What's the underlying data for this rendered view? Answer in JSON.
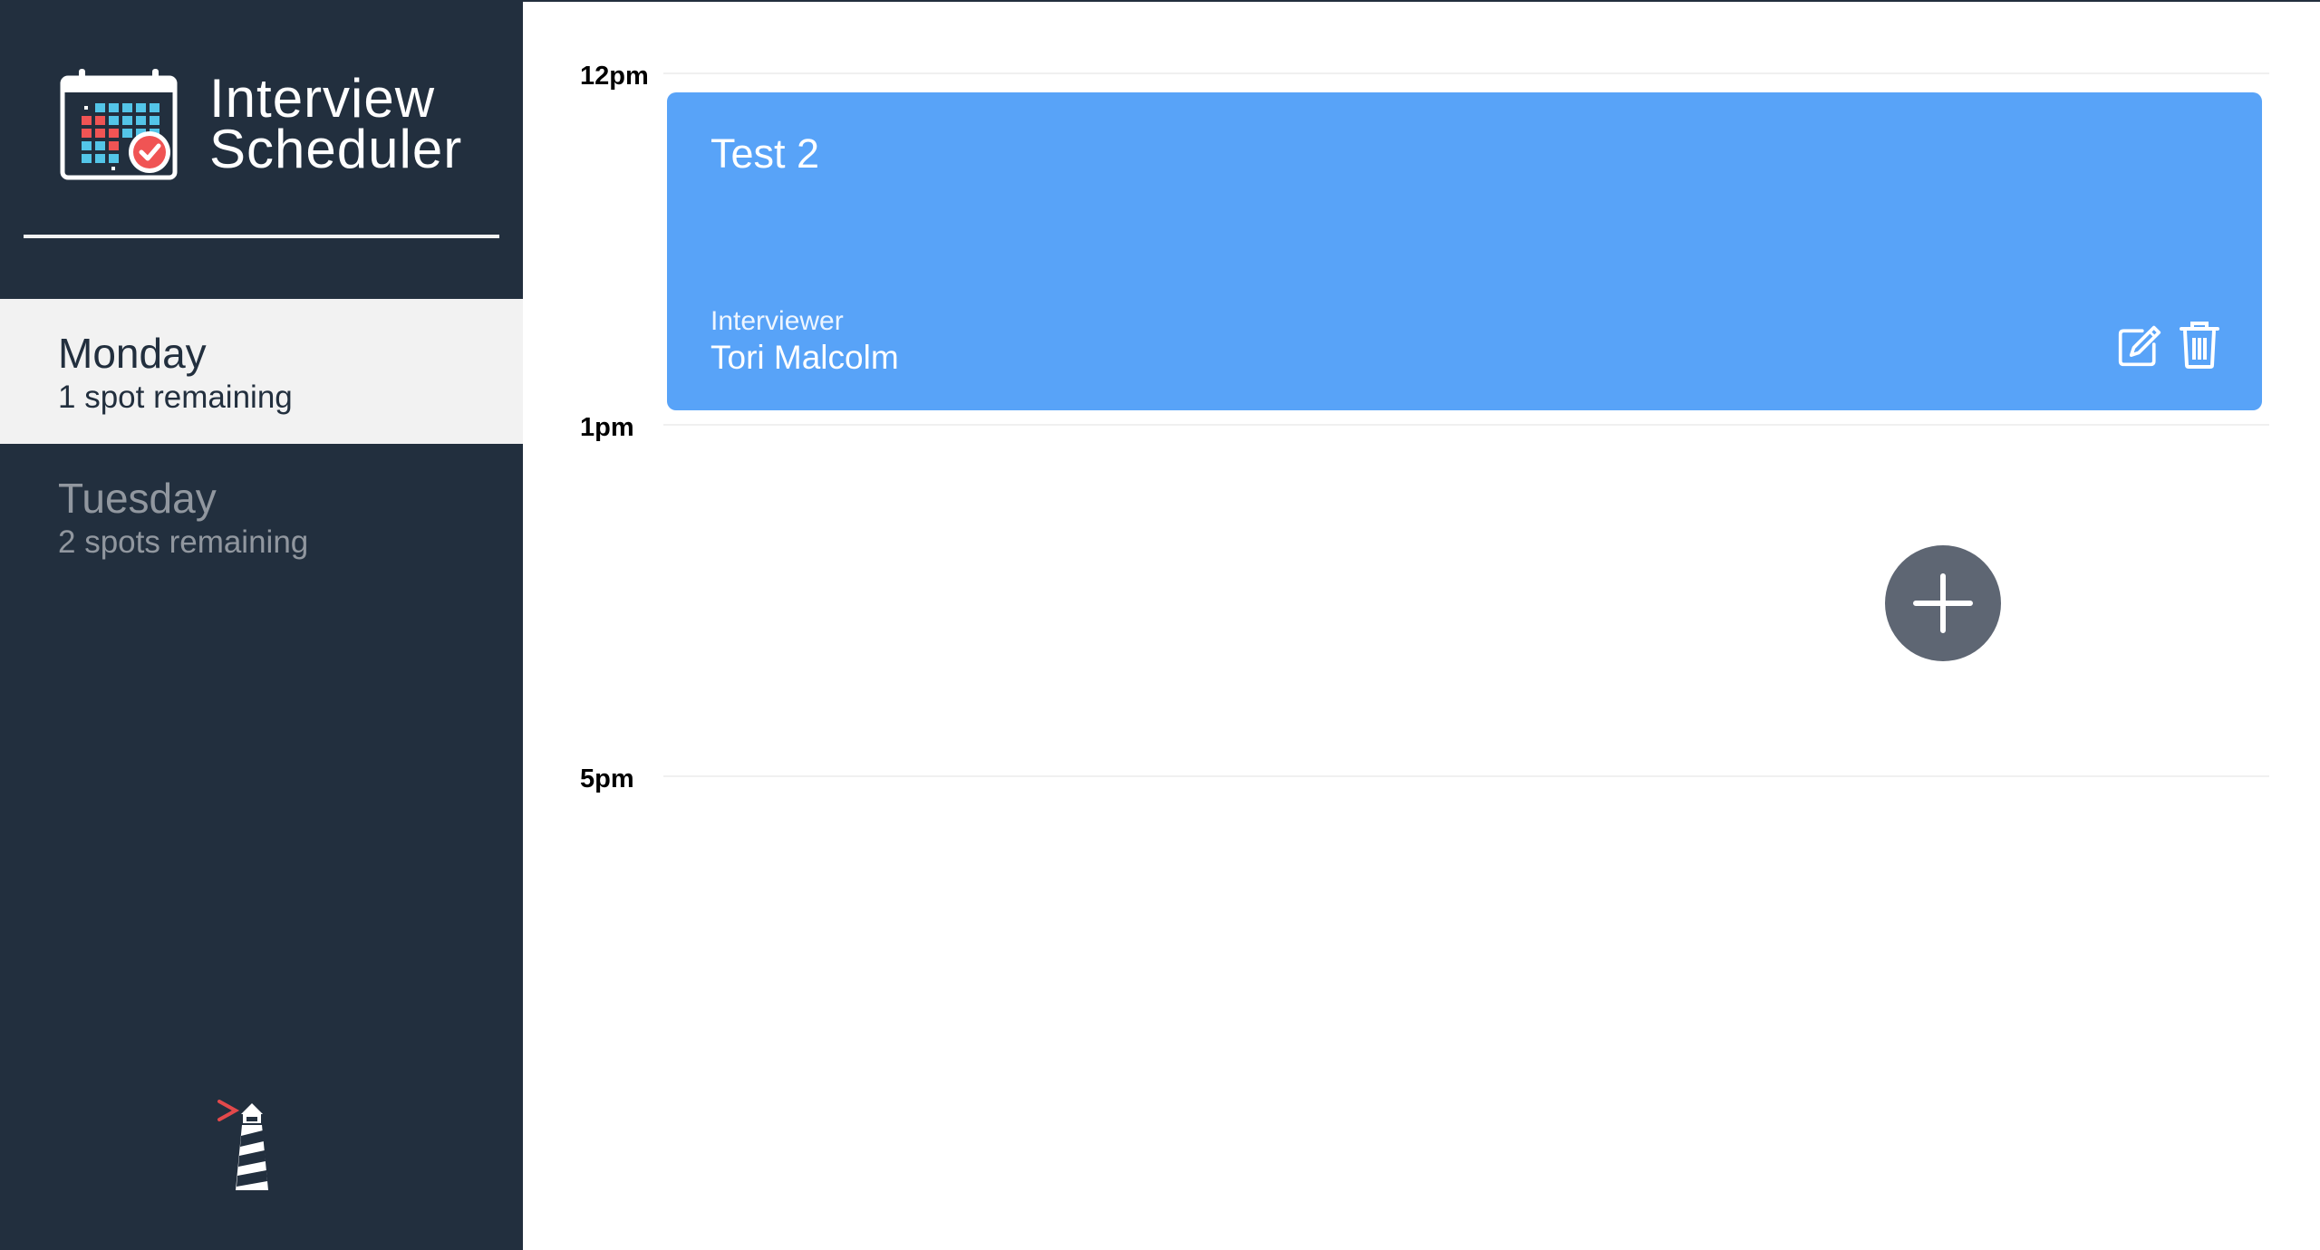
{
  "app": {
    "title_line1": "Interview",
    "title_line2": "Scheduler"
  },
  "days": [
    {
      "name": "Monday",
      "spots": "1 spot remaining",
      "selected": true
    },
    {
      "name": "Tuesday",
      "spots": "2 spots remaining",
      "selected": false
    }
  ],
  "schedule": {
    "times": [
      "12pm",
      "1pm",
      "5pm"
    ],
    "appointment": {
      "student": "Test 2",
      "interviewer_label": "Interviewer",
      "interviewer_name": "Tori Malcolm"
    }
  },
  "colors": {
    "sidebar": "#222f3e",
    "selected_day": "#f2f2f2",
    "appointment": "#58a3f8",
    "add_button": "#5e6673"
  },
  "icons": {
    "logo": "calendar-check-icon",
    "edit": "edit-icon",
    "delete": "trash-icon",
    "add": "plus-icon",
    "footer": "lighthouse-icon"
  }
}
